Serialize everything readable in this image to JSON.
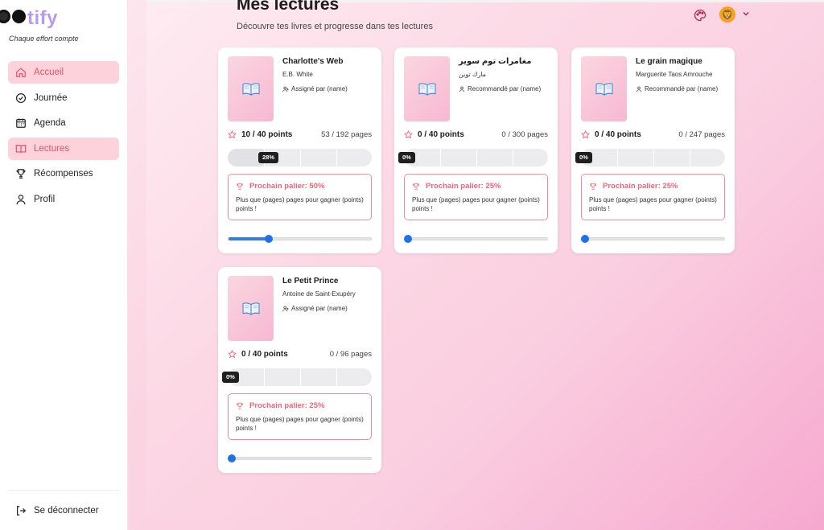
{
  "brand": {
    "logo_text": "tify",
    "tagline": "Chaque effort compte"
  },
  "sidebar": {
    "items": [
      {
        "label": "Accueil",
        "icon": "home-icon",
        "active": true
      },
      {
        "label": "Journée",
        "icon": "check-circle-icon",
        "active": false
      },
      {
        "label": "Agenda",
        "icon": "calendar-icon",
        "active": false
      },
      {
        "label": "Lectures",
        "icon": "book-open-icon",
        "active": true
      },
      {
        "label": "Récompenses",
        "icon": "trophy-icon",
        "active": false
      },
      {
        "label": "Profil",
        "icon": "user-icon",
        "active": false
      }
    ],
    "logout": "Se déconnecter"
  },
  "header": {
    "title": "Mes lectures",
    "subtitle": "Découvre tes livres et progresse dans tes lectures",
    "avatar_icon": "lion-avatar-icon"
  },
  "colors": {
    "accent": "#e2536b",
    "active_bg": "#fdd2da",
    "progress_blue": "#2f7fe6",
    "palier_border": "#f08a9c"
  },
  "books": [
    {
      "title": "Charlotte's Web",
      "author": "E.B. White",
      "meta": "Assigné par (name)",
      "points": "10 / 40 points",
      "pages": "53 / 192 pages",
      "percent_label": "28%",
      "progress": 0.28,
      "palier_title": "Prochain palier: 50%",
      "palier_text": "Plus que (pages) pages pour gagner (points) points !",
      "slider": 0.28
    },
    {
      "title": "مغامرات توم سوير",
      "author": "مارك توين",
      "meta": "Recommandé par (name)",
      "points": "0 / 40 points",
      "pages": "0 / 300 pages",
      "percent_label": "0%",
      "progress": 0,
      "palier_title": "Prochain palier: 25%",
      "palier_text": "Plus que (pages) pages pour gagner (points) points !",
      "slider": 0
    },
    {
      "title": "Le grain magique",
      "author": "Marguerite Taos Amrouche",
      "meta": "Recommandé par (name)",
      "points": "0 / 40 points",
      "pages": "0 / 247 pages",
      "percent_label": "0%",
      "progress": 0,
      "palier_title": "Prochain palier: 25%",
      "palier_text": "Plus que (pages) pages pour gagner (points) points !",
      "slider": 0
    },
    {
      "title": "Le Petit Prince",
      "author": "Antoine de Saint-Exupéry",
      "meta": "Assigné par (name)",
      "points": "0 / 40 points",
      "pages": "0 / 96 pages",
      "percent_label": "0%",
      "progress": 0,
      "palier_title": "Prochain palier: 25%",
      "palier_text": "Plus que (pages) pages pour gagner (points) points !",
      "slider": 0
    }
  ]
}
